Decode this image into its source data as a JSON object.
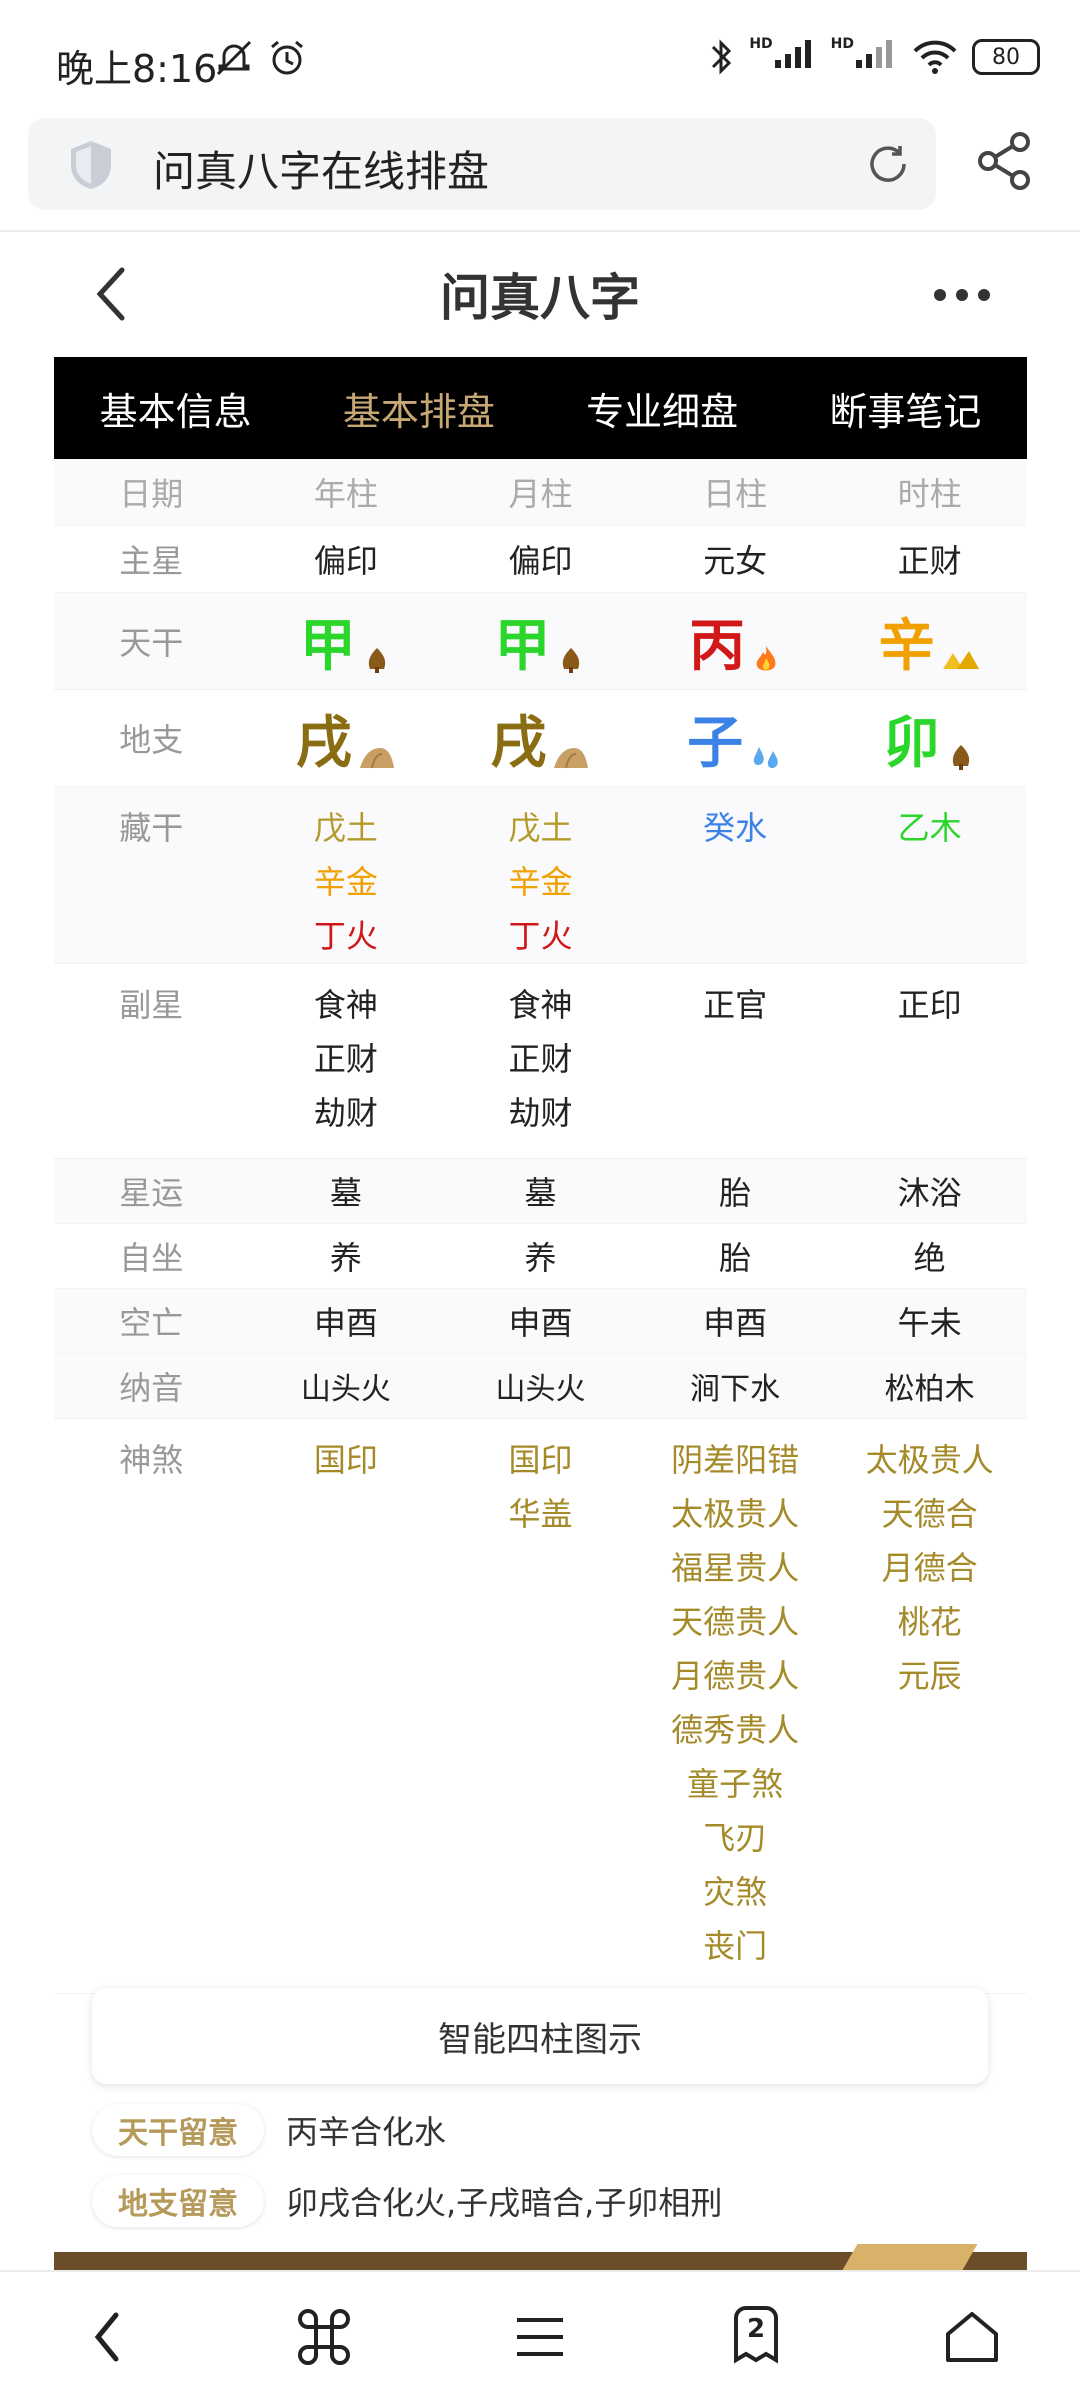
{
  "status_bar": {
    "time": "晚上8:16",
    "battery": "80",
    "signal_badge": "HD"
  },
  "browser": {
    "page_title": "问真八字在线排盘"
  },
  "app": {
    "title": "问真八字"
  },
  "tabs": [
    "基本信息",
    "基本排盘",
    "专业细盘",
    "断事笔记"
  ],
  "active_tab": "基本排盘",
  "table": {
    "header": [
      "日期",
      "年柱",
      "月柱",
      "日柱",
      "时柱"
    ],
    "main_star": {
      "label": "主星",
      "values": [
        "偏印",
        "偏印",
        "元女",
        "正财"
      ]
    },
    "stems": {
      "label": "天干",
      "values": [
        "甲",
        "甲",
        "丙",
        "辛"
      ]
    },
    "branches": {
      "label": "地支",
      "values": [
        "戌",
        "戌",
        "子",
        "卯"
      ]
    },
    "hidden_stems": {
      "label": "藏干",
      "values": [
        [
          "戊土",
          "辛金",
          "丁火"
        ],
        [
          "戊土",
          "辛金",
          "丁火"
        ],
        [
          "癸水"
        ],
        [
          "乙木"
        ]
      ]
    },
    "side_stars": {
      "label": "副星",
      "values": [
        [
          "食神",
          "正财",
          "劫财"
        ],
        [
          "食神",
          "正财",
          "劫财"
        ],
        [
          "正官"
        ],
        [
          "正印"
        ]
      ]
    },
    "star_fortune": {
      "label": "星运",
      "values": [
        "墓",
        "墓",
        "胎",
        "沐浴"
      ]
    },
    "self_sitting": {
      "label": "自坐",
      "values": [
        "养",
        "养",
        "胎",
        "绝"
      ]
    },
    "void": {
      "label": "空亡",
      "values": [
        "申酉",
        "申酉",
        "申酉",
        "午未"
      ]
    },
    "nayin": {
      "label": "纳音",
      "values": [
        "山头火",
        "山头火",
        "涧下水",
        "松柏木"
      ]
    },
    "shensha": {
      "label": "神煞",
      "values": [
        [
          "国印"
        ],
        [
          "国印",
          "华盖"
        ],
        [
          "阴差阳错",
          "太极贵人",
          "福星贵人",
          "天德贵人",
          "月德贵人",
          "德秀贵人",
          "童子煞",
          "飞刃",
          "灾煞",
          "丧门"
        ],
        [
          "太极贵人",
          "天德合",
          "月德合",
          "桃花",
          "元辰"
        ]
      ]
    }
  },
  "diagram_button": "智能四柱图示",
  "notes": [
    {
      "tag": "天干留意",
      "text": "丙辛合化水"
    },
    {
      "tag": "地支留意",
      "text": "卯戌合化火,子戌暗合,子卯相刑"
    }
  ],
  "bottom_nav": {
    "tabs_count": "2"
  }
}
